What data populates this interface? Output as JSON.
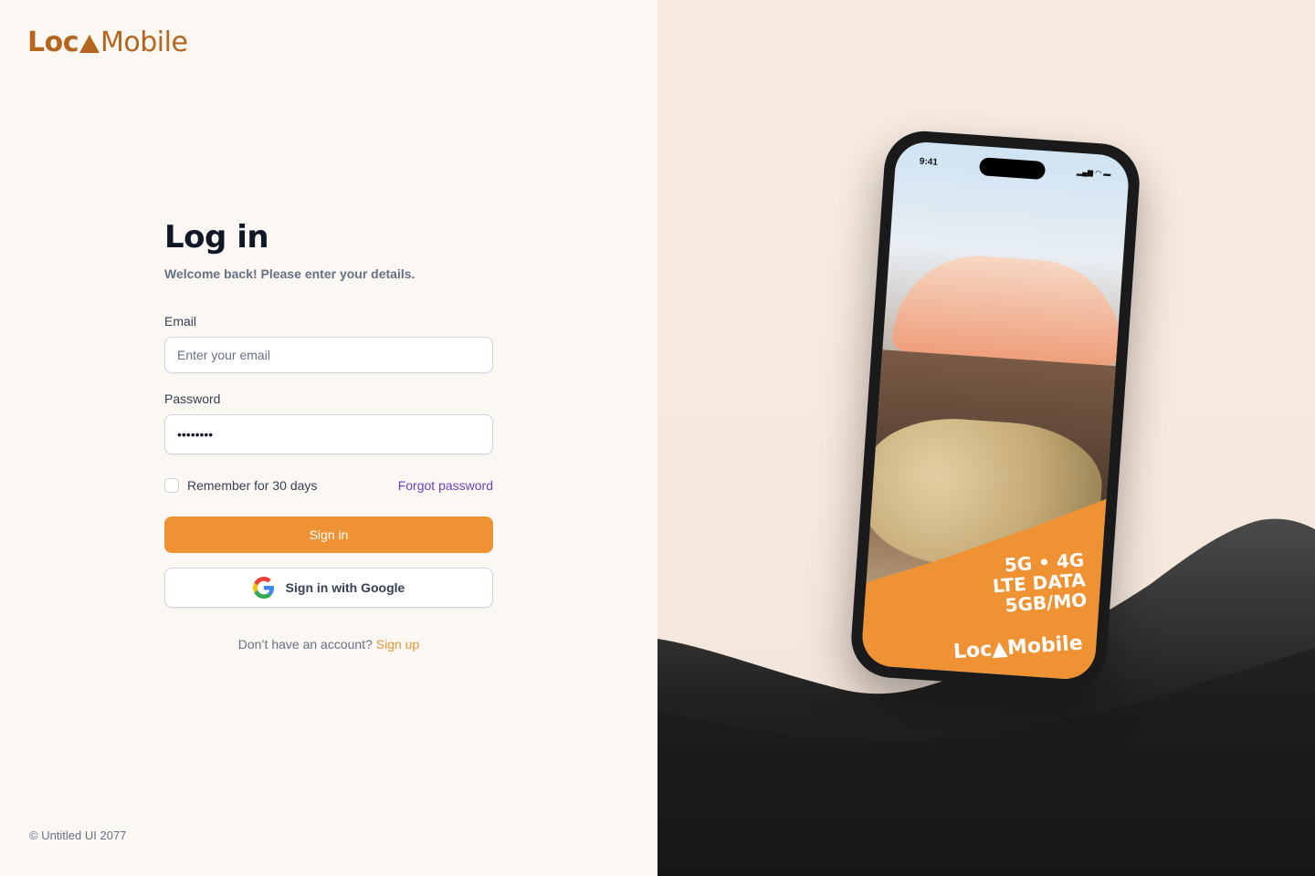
{
  "brand": {
    "logo_left": "Loc",
    "logo_right": "Mobile"
  },
  "login": {
    "title": "Log in",
    "subtitle": "Welcome back! Please enter your details.",
    "email_label": "Email",
    "email_placeholder": "Enter your email",
    "password_label": "Password",
    "password_value": "••••••••",
    "remember_label": "Remember for 30 days",
    "forgot_label": "Forgot password",
    "signin_label": "Sign in",
    "google_label": "Sign in with Google",
    "no_account_text": "Don’t have an account?",
    "signup_label": "Sign up"
  },
  "footer": {
    "copyright": "© Untitled UI 2077"
  },
  "promo": {
    "time": "9:41",
    "line1": "5G • 4G",
    "line2": "LTE DATA",
    "line3": "5GB/MO",
    "logo_left": "Loc",
    "logo_right": "Mobile"
  },
  "colors": {
    "accent": "#ef9233",
    "brand": "#b5651d",
    "link": "#6941c6"
  }
}
